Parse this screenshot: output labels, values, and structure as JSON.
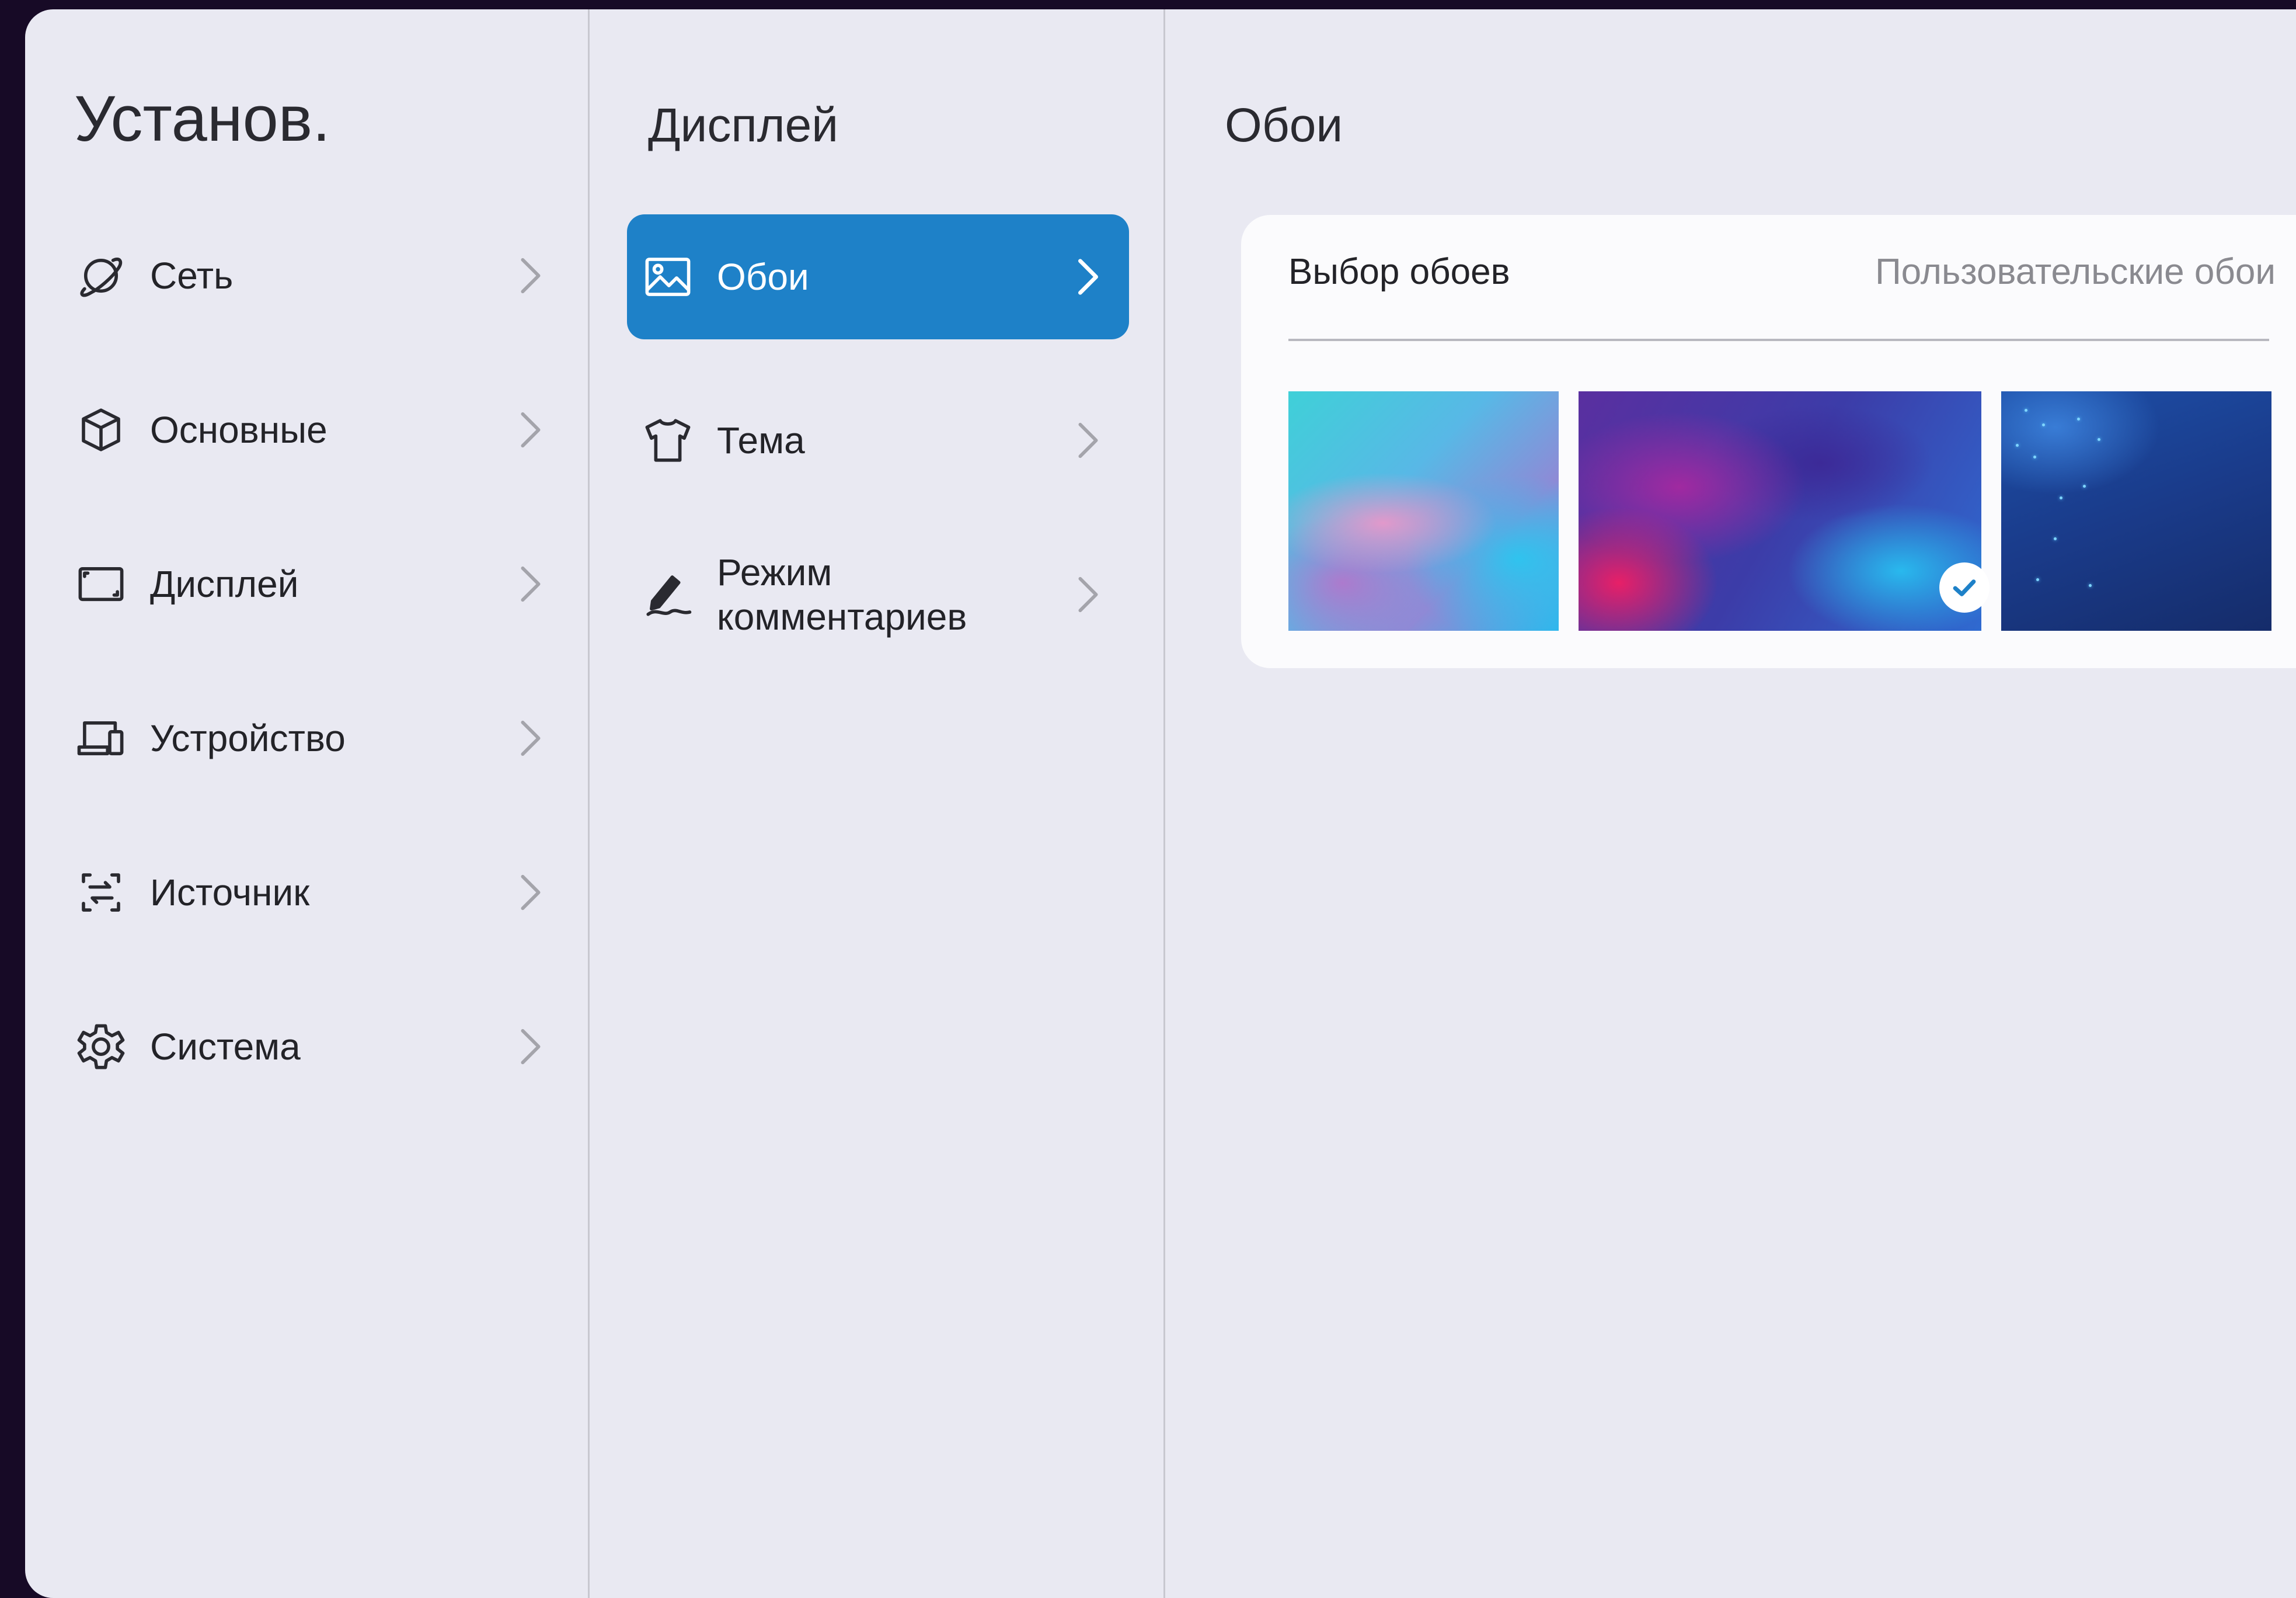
{
  "sidebar": {
    "title": "Установ.",
    "items": [
      {
        "label": "Сеть",
        "icon": "network-icon"
      },
      {
        "label": "Основные",
        "icon": "cube-icon"
      },
      {
        "label": "Дисплей",
        "icon": "display-icon"
      },
      {
        "label": "Устройство",
        "icon": "device-icon"
      },
      {
        "label": "Источник",
        "icon": "source-icon"
      },
      {
        "label": "Система",
        "icon": "gear-icon"
      }
    ]
  },
  "submenu": {
    "title": "Дисплей",
    "items": [
      {
        "label": "Обои",
        "icon": "image-icon",
        "active": true
      },
      {
        "label": "Тема",
        "icon": "tshirt-icon",
        "active": false
      },
      {
        "label": "Режим\nкомментариев",
        "icon": "pen-icon",
        "active": false
      }
    ]
  },
  "detail": {
    "title": "Обои",
    "wallpaper_choice_label": "Выбор обоев",
    "wallpaper_choice_value": "Пользовательские обои",
    "selected_wallpaper_index": 1
  },
  "colors": {
    "accent": "#1e81c8",
    "panel_bg": "#e9e9f2",
    "card_bg": "#fbfbfd",
    "outer_bg": "#170a26"
  }
}
